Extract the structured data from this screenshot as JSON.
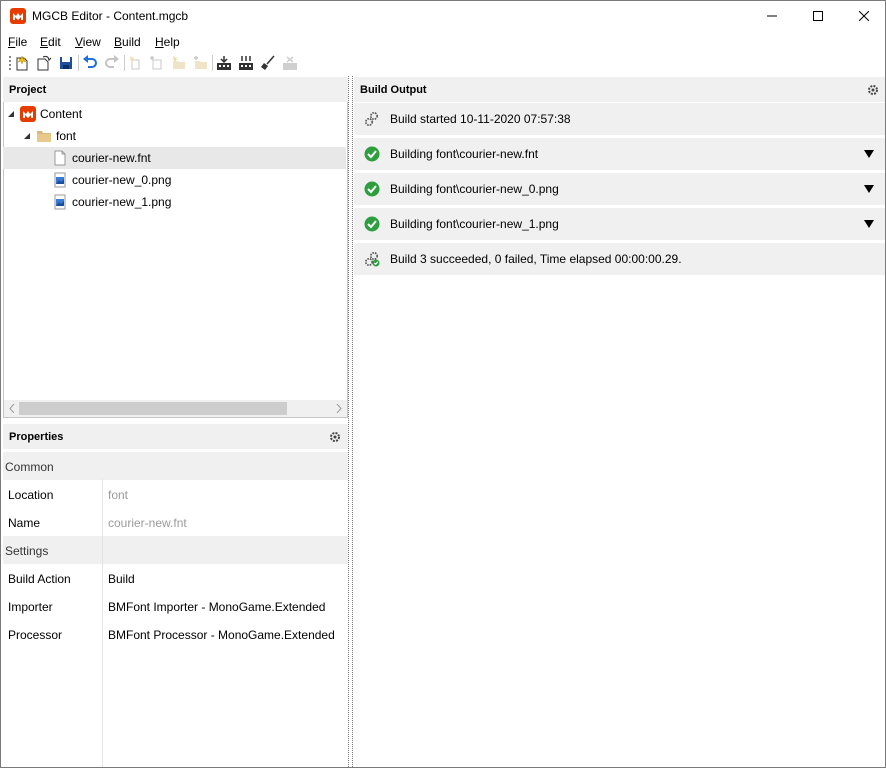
{
  "window": {
    "title": "MGCB Editor - Content.mgcb",
    "minimize_icon": "minimize-icon",
    "maximize_icon": "maximize-icon",
    "close_icon": "close-icon"
  },
  "menu": [
    {
      "label": "File",
      "mnemonic": "F"
    },
    {
      "label": "Edit",
      "mnemonic": "E"
    },
    {
      "label": "View",
      "mnemonic": "V"
    },
    {
      "label": "Build",
      "mnemonic": "B"
    },
    {
      "label": "Help",
      "mnemonic": "H"
    }
  ],
  "toolbar": [
    {
      "name": "new-project",
      "icon": "new-project-icon",
      "enabled": true
    },
    {
      "name": "open-project",
      "icon": "open-project-icon",
      "enabled": true
    },
    {
      "name": "save-project",
      "icon": "save-icon",
      "enabled": true
    },
    {
      "name": "undo",
      "icon": "undo-icon",
      "enabled": true
    },
    {
      "name": "redo",
      "icon": "redo-icon",
      "enabled": false
    },
    {
      "name": "new-item",
      "icon": "new-item-icon",
      "enabled": false
    },
    {
      "name": "add-existing-item",
      "icon": "add-existing-item-icon",
      "enabled": false
    },
    {
      "name": "new-folder",
      "icon": "new-folder-icon",
      "enabled": false
    },
    {
      "name": "add-existing-folder",
      "icon": "add-existing-folder-icon",
      "enabled": false
    },
    {
      "name": "build",
      "icon": "build-icon",
      "enabled": true
    },
    {
      "name": "rebuild",
      "icon": "rebuild-icon",
      "enabled": true
    },
    {
      "name": "clean",
      "icon": "clean-icon",
      "enabled": true
    },
    {
      "name": "cancel-build",
      "icon": "cancel-build-icon",
      "enabled": false
    }
  ],
  "project_panel": {
    "header": "Project",
    "tree": [
      {
        "label": "Content",
        "icon": "monogame-logo-icon",
        "expanded": true,
        "selected": false
      },
      {
        "label": "font",
        "icon": "folder-icon",
        "expanded": true,
        "selected": false
      },
      {
        "label": "courier-new.fnt",
        "icon": "file-icon",
        "selected": true
      },
      {
        "label": "courier-new_0.png",
        "icon": "image-file-icon",
        "selected": false
      },
      {
        "label": "courier-new_1.png",
        "icon": "image-file-icon",
        "selected": false
      }
    ]
  },
  "properties_panel": {
    "header": "Properties",
    "categories": [
      {
        "name": "Common",
        "rows": [
          {
            "name": "Location",
            "value": "font",
            "readonly": true
          },
          {
            "name": "Name",
            "value": "courier-new.fnt",
            "readonly": true
          }
        ]
      },
      {
        "name": "Settings",
        "rows": [
          {
            "name": "Build Action",
            "value": "Build",
            "readonly": false
          },
          {
            "name": "Importer",
            "value": "BMFont Importer - MonoGame.Extended",
            "readonly": false
          },
          {
            "name": "Processor",
            "value": "BMFont Processor - MonoGame.Extended",
            "readonly": false
          }
        ]
      }
    ]
  },
  "build_output": {
    "header": "Build Output",
    "entries": [
      {
        "text": "Build started 10-11-2020 07:57:38",
        "icon": "build-gears-icon",
        "expandable": false
      },
      {
        "text": "Building font\\courier-new.fnt",
        "icon": "success-check-icon",
        "expandable": true
      },
      {
        "text": "Building font\\courier-new_0.png",
        "icon": "success-check-icon",
        "expandable": true
      },
      {
        "text": "Building font\\courier-new_1.png",
        "icon": "success-check-icon",
        "expandable": true
      },
      {
        "text": "Build 3 succeeded, 0 failed, Time elapsed 00:00:00.29.",
        "icon": "build-succeeded-icon",
        "expandable": false
      }
    ]
  },
  "colors": {
    "accent_monogame": "#e73c00",
    "success_green": "#2e9e3e",
    "save_blue": "#1f4e9a",
    "undo_blue": "#1e6fd9",
    "folder_tan": "#dcb67a"
  }
}
